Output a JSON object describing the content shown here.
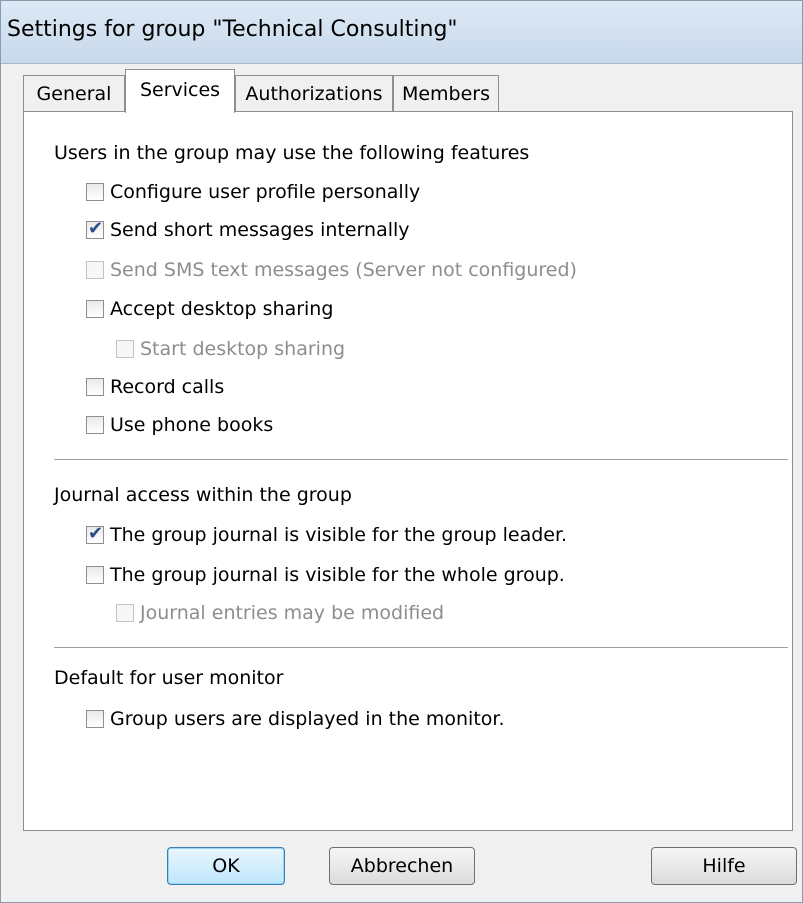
{
  "window": {
    "title": "Settings for group \"Technical Consulting\""
  },
  "tabs": [
    {
      "label": "General",
      "active": false
    },
    {
      "label": "Services",
      "active": true
    },
    {
      "label": "Authorizations",
      "active": false
    },
    {
      "label": "Members",
      "active": false
    }
  ],
  "features": {
    "heading": "Users in the group may use the following features",
    "items": [
      {
        "label": "Configure user profile personally",
        "checked": false,
        "enabled": true
      },
      {
        "label": "Send short messages internally",
        "checked": true,
        "enabled": true
      },
      {
        "label": "Send SMS text messages (Server not configured)",
        "checked": false,
        "enabled": false
      },
      {
        "label": "Accept desktop sharing",
        "checked": false,
        "enabled": true
      },
      {
        "label": "Start desktop sharing",
        "checked": false,
        "enabled": false
      },
      {
        "label": "Record calls",
        "checked": false,
        "enabled": true
      },
      {
        "label": "Use phone books",
        "checked": false,
        "enabled": true
      }
    ]
  },
  "journal": {
    "heading": "Journal access within the group",
    "items": [
      {
        "label": "The group journal is visible for the group leader.",
        "checked": true,
        "enabled": true
      },
      {
        "label": "The group journal is visible for the whole group.",
        "checked": false,
        "enabled": true
      },
      {
        "label": "Journal entries may be modified",
        "checked": false,
        "enabled": false
      }
    ]
  },
  "monitor": {
    "heading": "Default for user monitor",
    "items": [
      {
        "label": "Group users are displayed in the monitor.",
        "checked": false,
        "enabled": true
      }
    ]
  },
  "buttons": {
    "ok": "OK",
    "cancel": "Abbrechen",
    "help": "Hilfe"
  },
  "colors": {
    "check": "#2b4c8a",
    "disabled_text": "#8d8d8d",
    "default_button_border": "#3c7fb1"
  }
}
